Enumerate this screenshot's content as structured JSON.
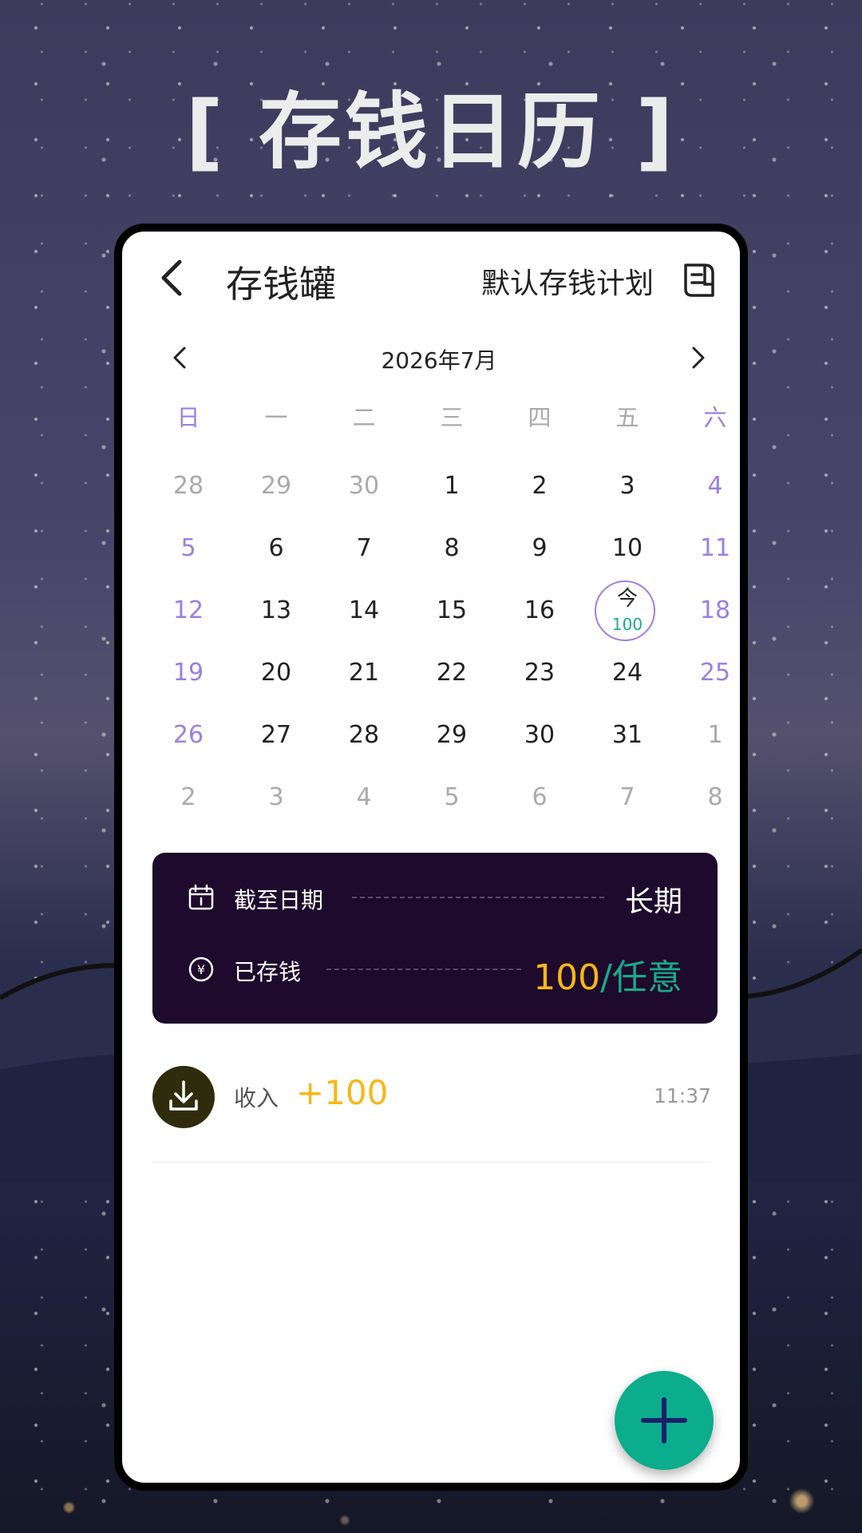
{
  "promo": {
    "title": "[ 存钱日历 ]"
  },
  "header": {
    "title": "存钱罐",
    "plan_label": "默认存钱计划"
  },
  "calendar": {
    "month_label": "2026年7月",
    "weekdays": [
      "日",
      "一",
      "二",
      "三",
      "四",
      "五",
      "六"
    ],
    "days": [
      [
        "28",
        "29",
        "30",
        "1",
        "2",
        "3",
        "4"
      ],
      [
        "5",
        "6",
        "7",
        "8",
        "9",
        "10",
        "11"
      ],
      [
        "12",
        "13",
        "14",
        "15",
        "16",
        "今",
        "18"
      ],
      [
        "19",
        "20",
        "21",
        "22",
        "23",
        "24",
        "25"
      ],
      [
        "26",
        "27",
        "28",
        "29",
        "30",
        "31",
        "1"
      ],
      [
        "2",
        "3",
        "4",
        "5",
        "6",
        "7",
        "8"
      ]
    ],
    "today": {
      "mark": "今",
      "amount": "100"
    }
  },
  "summary": {
    "deadline_label": "截至日期",
    "deadline_value": "长期",
    "saved_label": "已存钱",
    "saved_amount": "100",
    "saved_target": "/任意"
  },
  "transactions": [
    {
      "type": "收入",
      "amount": "+100",
      "time": "11:37"
    }
  ],
  "colors": {
    "accent": "#0bad8c",
    "weekend": "#9b7fe0",
    "amount": "#f7b718",
    "summary_bg": "#1e0a2c",
    "income_icon_bg": "#2e2c0c"
  },
  "icons": {
    "back": "chevron-left-icon",
    "plan": "document-icon",
    "prev_month": "chevron-left-icon",
    "next_month": "chevron-right-icon",
    "deadline": "calendar-icon",
    "saved": "yuan-coin-icon",
    "income": "download-icon",
    "fab": "plus-icon"
  }
}
